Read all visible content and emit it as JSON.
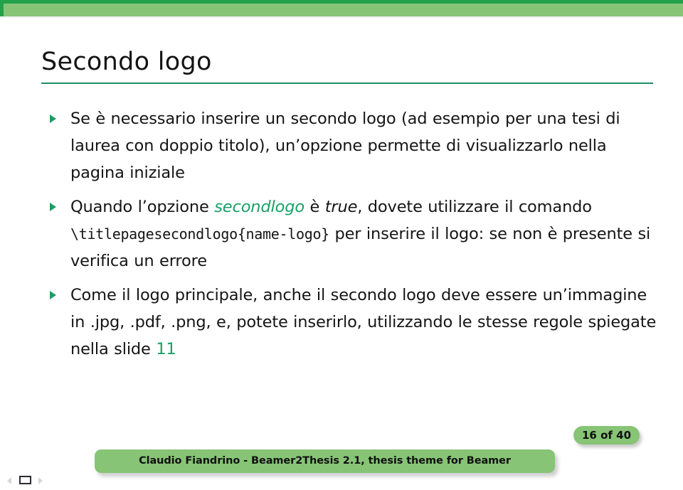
{
  "theme": {
    "accent_dark_green": "#22a04a",
    "accent_light_green": "#87c476",
    "rule_green": "#1f8f66",
    "link_green": "#19a066",
    "text_color": "#151515",
    "background": "#ffffff"
  },
  "slide": {
    "title": "Secondo logo"
  },
  "bullets": [
    {
      "marker": "triangle-right-bullet",
      "runs": [
        {
          "type": "text",
          "value": "Se è necessario inserire un secondo logo (ad esempio per una tesi di laurea con doppio titolo), un’opzione permette di visualizzarlo nella pagina iniziale"
        }
      ]
    },
    {
      "marker": "triangle-right-bullet",
      "runs": [
        {
          "type": "text",
          "value": "Quando l’opzione "
        },
        {
          "type": "emph-green",
          "value": "secondlogo"
        },
        {
          "type": "text",
          "value": " è "
        },
        {
          "type": "emph-italic",
          "value": "true"
        },
        {
          "type": "text",
          "value": ", dovete utilizzare il comando "
        },
        {
          "type": "mono",
          "value": "\\titlepagesecondlogo{name-logo}"
        },
        {
          "type": "text",
          "value": " per inserire il logo: se non è presente si verifica un errore"
        }
      ]
    },
    {
      "marker": "triangle-right-bullet",
      "runs": [
        {
          "type": "text",
          "value": "Come il logo principale, anche il secondo logo deve essere un’immagine in .jpg, .pdf, .png, e, potete inserirlo, utilizzando le stesse regole spiegate nella slide "
        },
        {
          "type": "link",
          "value": "11"
        }
      ]
    }
  ],
  "footer": {
    "page_badge": "16 of 40",
    "author_line": "Claudio Fiandrino - Beamer2Thesis 2.1, thesis theme for Beamer"
  },
  "navigation": {
    "prev_icon": "triangle-left-icon",
    "frame_icon": "frame-rectangle-icon",
    "next_icon": "triangle-right-icon"
  }
}
